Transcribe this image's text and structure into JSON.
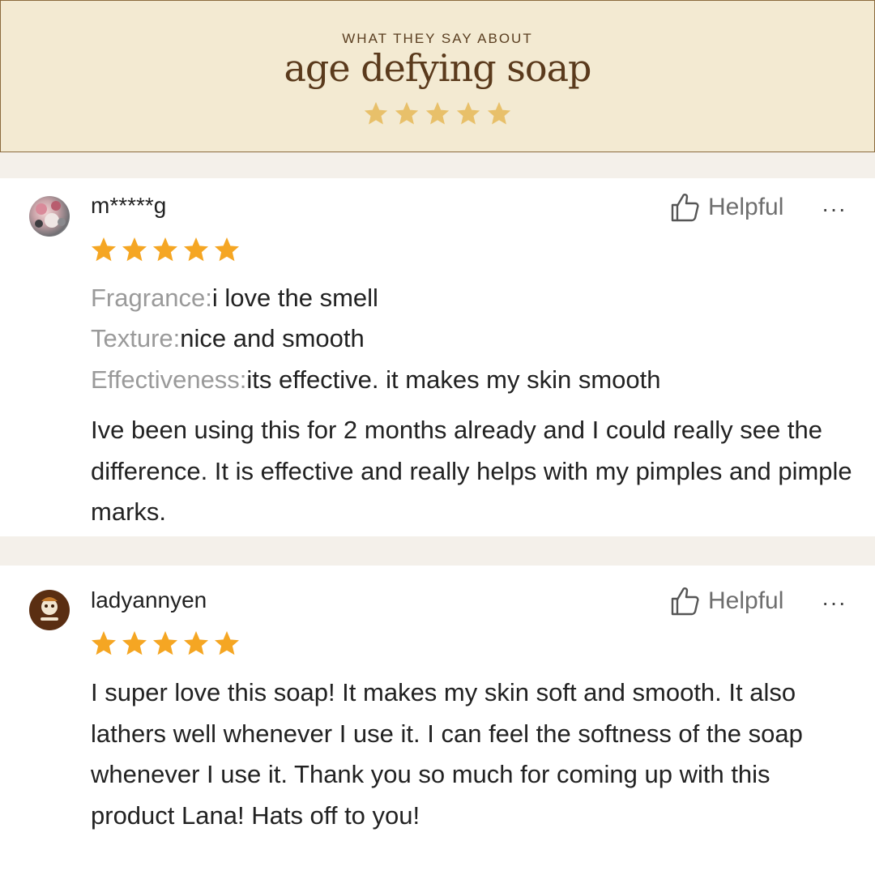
{
  "header": {
    "eyebrow": "WHAT THEY SAY ABOUT",
    "title": "age defying soap",
    "rating": 5,
    "star_color": "#e8c06a"
  },
  "reviews": [
    {
      "username": "m*****g",
      "rating": 5,
      "helpful_label": "Helpful",
      "more_label": "···",
      "attributes": [
        {
          "label": "Fragrance:",
          "value": "i love the smell"
        },
        {
          "label": "Texture:",
          "value": "nice and smooth"
        },
        {
          "label": "Effectiveness:",
          "value": "its effective. it makes my skin smooth"
        }
      ],
      "text": "Ive been using this for 2 months already and I could really see the difference. It is effective and really helps with my pimples and pimple marks."
    },
    {
      "username": "ladyannyen",
      "rating": 5,
      "helpful_label": "Helpful",
      "more_label": "···",
      "text": "I super love this soap! It makes my skin soft and smooth. It also lathers well whenever I use it. I can feel the softness of the soap whenever I use it. Thank you so much for coming up with this product Lana! Hats off to you!"
    }
  ],
  "colors": {
    "review_star": "#f5a623",
    "divider_bg": "#f4f0ea"
  }
}
